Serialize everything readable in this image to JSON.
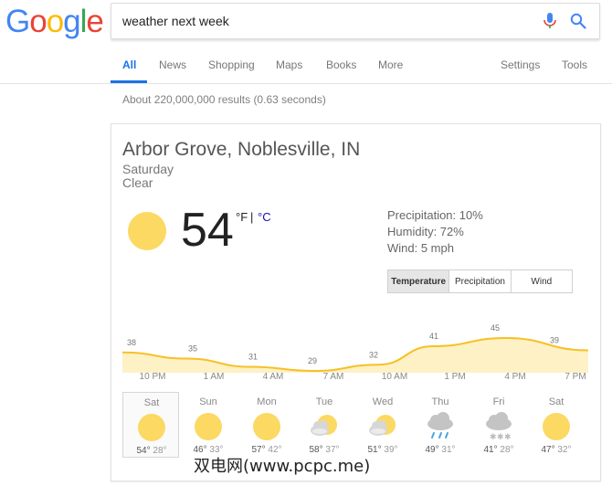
{
  "logo": {
    "letters": [
      {
        "ch": "G",
        "color": "#4285F4"
      },
      {
        "ch": "o",
        "color": "#EA4335"
      },
      {
        "ch": "o",
        "color": "#FBBC05"
      },
      {
        "ch": "g",
        "color": "#4285F4"
      },
      {
        "ch": "l",
        "color": "#34A853"
      },
      {
        "ch": "e",
        "color": "#EA4335"
      }
    ]
  },
  "search": {
    "query": "weather next week",
    "icons": [
      "mic-icon",
      "search-icon"
    ]
  },
  "tabs": [
    {
      "label": "All",
      "active": true
    },
    {
      "label": "News"
    },
    {
      "label": "Shopping"
    },
    {
      "label": "Maps"
    },
    {
      "label": "Books"
    },
    {
      "label": "More"
    },
    {
      "label": "Settings"
    },
    {
      "label": "Tools"
    }
  ],
  "result_stats": "About 220,000,000 results (0.63 seconds)",
  "weather": {
    "location": "Arbor Grove, Noblesville, IN",
    "day": "Saturday",
    "condition": "Clear",
    "temperature": "54",
    "unit_f": "°F",
    "unit_sep": "|",
    "unit_c": "°C",
    "precipitation": "Precipitation: 10%",
    "humidity": "Humidity: 72%",
    "wind": "Wind: 5 mph",
    "chart_buttons": [
      {
        "label": "Temperature",
        "active": true
      },
      {
        "label": "Precipitation"
      },
      {
        "label": "Wind"
      }
    ],
    "chart_data": {
      "type": "area",
      "x": [
        "10 PM",
        "1 AM",
        "4 AM",
        "7 AM",
        "10 AM",
        "1 PM",
        "4 PM",
        "7 PM"
      ],
      "labels": [
        38,
        35,
        31,
        29,
        32,
        41,
        45,
        39
      ],
      "colors": {
        "line": "#f7c026",
        "fill": "#fdf1c5"
      }
    },
    "days": [
      {
        "name": "Sat",
        "hi": "54°",
        "lo": "28°",
        "icon": "sun-icon",
        "selected": true
      },
      {
        "name": "Sun",
        "hi": "46°",
        "lo": "33°",
        "icon": "sun-icon"
      },
      {
        "name": "Mon",
        "hi": "57°",
        "lo": "42°",
        "icon": "sun-icon"
      },
      {
        "name": "Tue",
        "hi": "58°",
        "lo": "37°",
        "icon": "partly-cloudy-icon"
      },
      {
        "name": "Wed",
        "hi": "51°",
        "lo": "39°",
        "icon": "partly-cloudy-icon"
      },
      {
        "name": "Thu",
        "hi": "49°",
        "lo": "31°",
        "icon": "rain-icon"
      },
      {
        "name": "Fri",
        "hi": "41°",
        "lo": "28°",
        "icon": "snow-icon"
      },
      {
        "name": "Sat",
        "hi": "47°",
        "lo": "32°",
        "icon": "sun-icon"
      }
    ]
  },
  "watermark": "双电网(www.pcpc.me)"
}
